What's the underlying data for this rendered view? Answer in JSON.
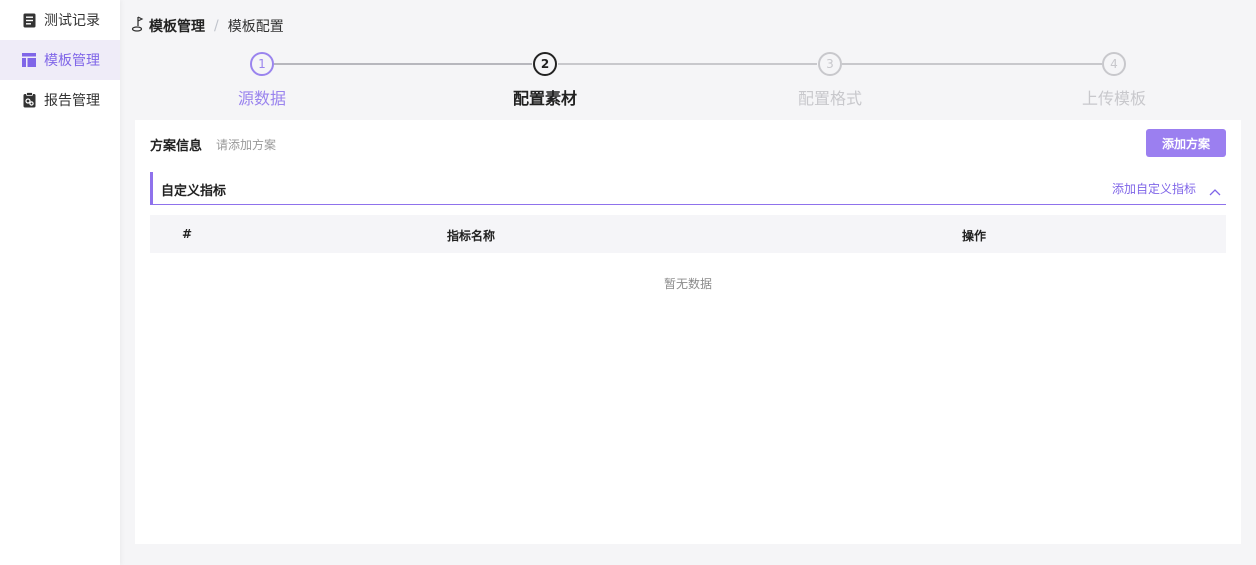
{
  "sidebar": {
    "items": [
      {
        "label": "测试记录",
        "icon": "document-list-icon",
        "active": false
      },
      {
        "label": "模板管理",
        "icon": "template-layout-icon",
        "active": true
      },
      {
        "label": "报告管理",
        "icon": "report-clipboard-icon",
        "active": false
      }
    ]
  },
  "breadcrumb": {
    "home_icon": "home-icon",
    "home": "模板管理",
    "separator": "/",
    "current": "模板配置"
  },
  "steps": [
    {
      "number": "1",
      "label": "源数据",
      "state": "done"
    },
    {
      "number": "2",
      "label": "配置素材",
      "state": "active"
    },
    {
      "number": "3",
      "label": "配置格式",
      "state": "pending"
    },
    {
      "number": "4",
      "label": "上传模板",
      "state": "pending"
    }
  ],
  "scheme": {
    "title": "方案信息",
    "hint": "请添加方案",
    "add_button": "添加方案"
  },
  "custom_metrics": {
    "title": "自定义指标",
    "add_link": "添加自定义指标",
    "collapse_icon": "chevron-up-icon",
    "table": {
      "columns": [
        "#",
        "指标名称",
        "操作"
      ],
      "empty_text": "暂无数据"
    }
  },
  "colors": {
    "accent": "#8066e8",
    "button": "#9b7ff0",
    "active_bg": "#efecf8",
    "pending": "#c8c8cc"
  }
}
